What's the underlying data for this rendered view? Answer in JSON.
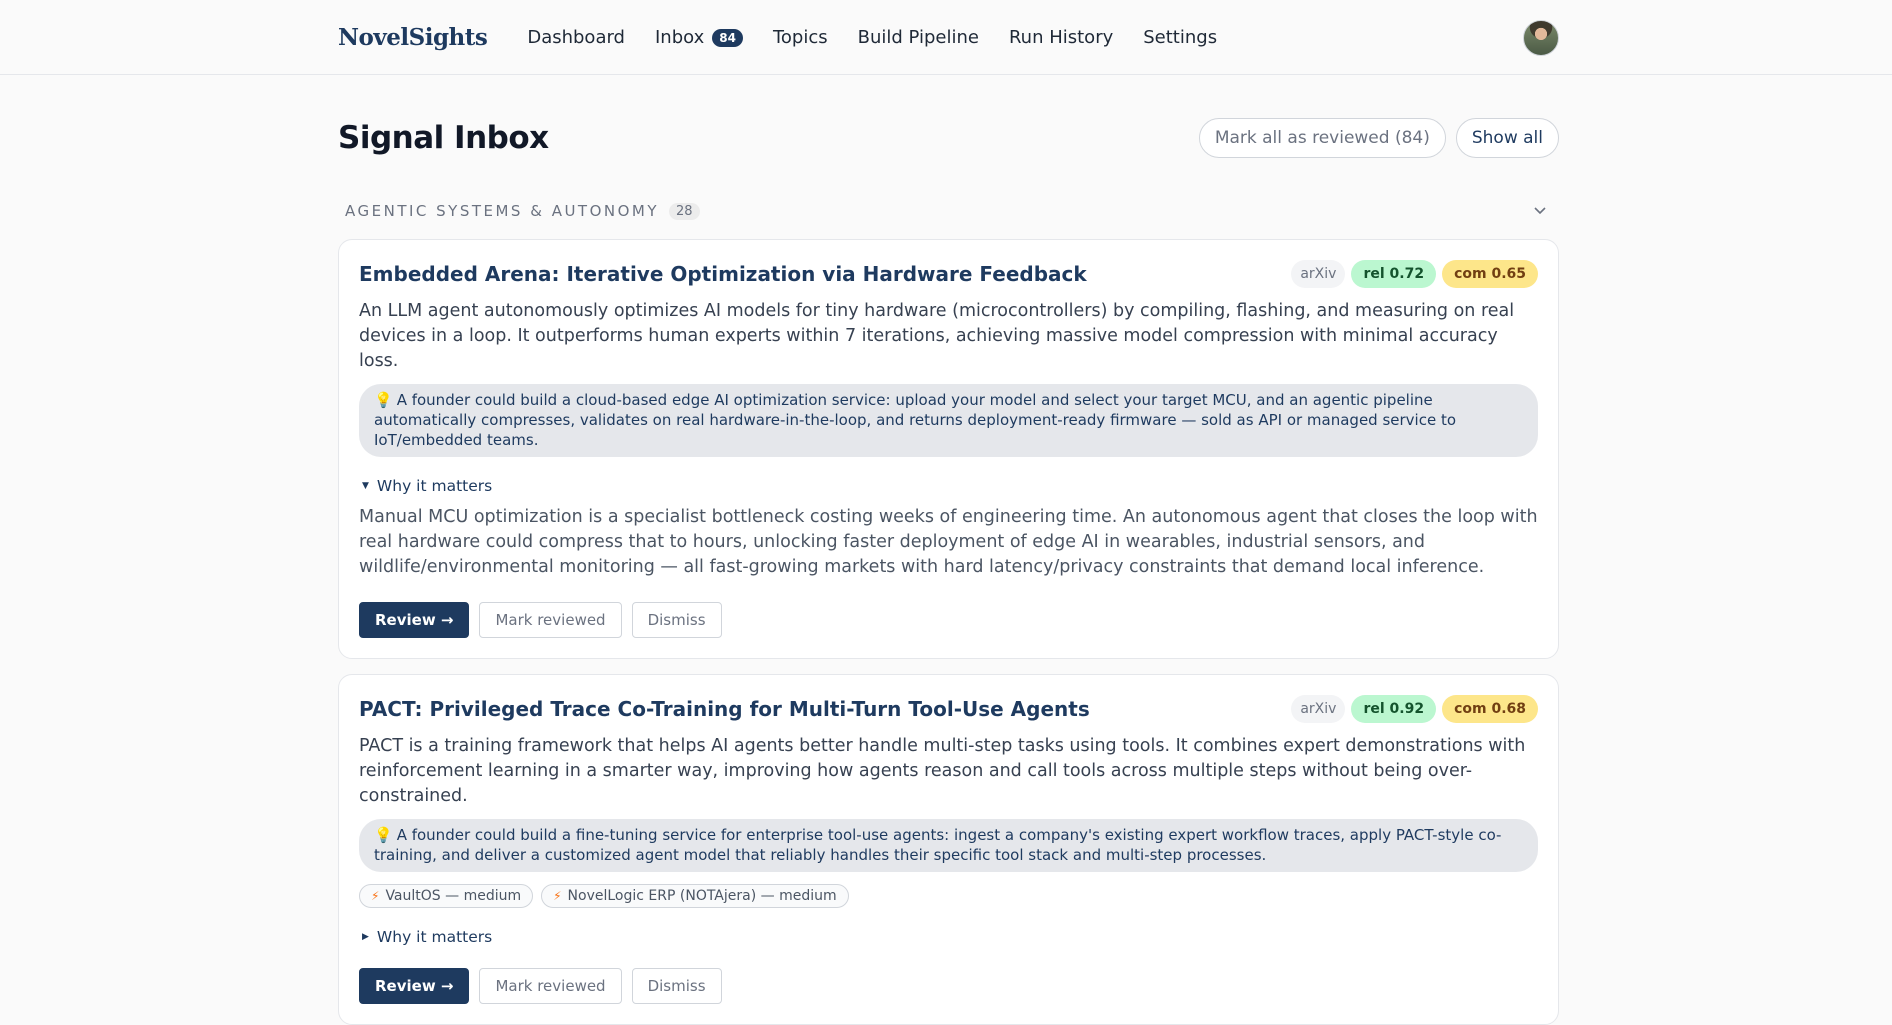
{
  "brand": {
    "logo": "NovelSights"
  },
  "nav": {
    "items": [
      {
        "label": "Dashboard"
      },
      {
        "label": "Inbox",
        "badge": "84"
      },
      {
        "label": "Topics"
      },
      {
        "label": "Build Pipeline"
      },
      {
        "label": "Run History"
      },
      {
        "label": "Settings"
      }
    ]
  },
  "page": {
    "title": "Signal Inbox",
    "mark_all_label": "Mark all as reviewed (84)",
    "show_all_label": "Show all"
  },
  "section": {
    "title": "AGENTIC SYSTEMS & AUTONOMY",
    "count": "28",
    "chevron": "chevron-down-icon"
  },
  "cards": [
    {
      "title": "Embedded Arena: Iterative Optimization via Hardware Feedback",
      "source": "arXiv",
      "rel": "rel 0.72",
      "com": "com 0.65",
      "summary": "An LLM agent autonomously optimizes AI models for tiny hardware (microcontrollers) by compiling, flashing, and measuring on real devices in a loop. It outperforms human experts within 7 iterations, achieving massive model compression with minimal accuracy loss.",
      "idea": "A founder could build a cloud-based edge AI optimization service: upload your model and select your target MCU, and an agentic pipeline automatically compresses, validates on real hardware-in-the-loop, and returns deployment-ready firmware — sold as API or managed service to IoT/embedded teams.",
      "why_label": "Why it matters",
      "why_body": "Manual MCU optimization is a specialist bottleneck costing weeks of engineering time. An autonomous agent that closes the loop with real hardware could compress that to hours, unlocking faster deployment of edge AI in wearables, industrial sensors, and wildlife/environmental monitoring — all fast-growing markets with hard latency/privacy constraints that demand local inference.",
      "review_label": "Review →",
      "mark_label": "Mark reviewed",
      "dismiss_label": "Dismiss"
    },
    {
      "title": "PACT: Privileged Trace Co-Training for Multi-Turn Tool-Use Agents",
      "source": "arXiv",
      "rel": "rel 0.92",
      "com": "com 0.68",
      "summary": "PACT is a training framework that helps AI agents better handle multi-step tasks using tools. It combines expert demonstrations with reinforcement learning in a smarter way, improving how agents reason and call tools across multiple steps without being over-constrained.",
      "idea": "A founder could build a fine-tuning service for enterprise tool-use agents: ingest a company's existing expert workflow traces, apply PACT-style co-training, and deliver a customized agent model that reliably handles their specific tool stack and multi-step processes.",
      "impacts": [
        "VaultOS — medium",
        "NovelLogic ERP (NOTAjera) — medium"
      ],
      "why_label": "Why it matters",
      "review_label": "Review →",
      "mark_label": "Mark reviewed",
      "dismiss_label": "Dismiss"
    }
  ]
}
